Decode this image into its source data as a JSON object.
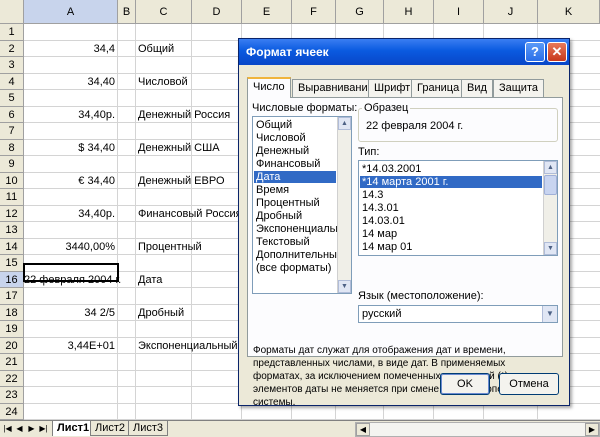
{
  "sheet": {
    "columns": [
      "A",
      "B",
      "C",
      "D",
      "E",
      "F",
      "G",
      "H",
      "I",
      "J",
      "K"
    ],
    "rows": [
      "1",
      "2",
      "3",
      "4",
      "5",
      "6",
      "7",
      "8",
      "9",
      "10",
      "11",
      "12",
      "13",
      "14",
      "15",
      "16",
      "17",
      "18",
      "19",
      "20",
      "21",
      "22",
      "23",
      "24"
    ],
    "selected_row": "16",
    "selected_col": "A",
    "cells_a": {
      "r2": "34,4",
      "r4": "34,40",
      "r6": "34,40р.",
      "r8": "$ 34,40",
      "r10": "€ 34,40",
      "r12": "34,40р.",
      "r14": "3440,00%",
      "r16": "22 февраля 2004 г.",
      "r18": "34 2/5",
      "r20": "3,44E+01"
    },
    "cells_c": {
      "r2": "Общий",
      "r4": "Числовой",
      "r6": "Денежный Россия",
      "r8": "Денежный США",
      "r10": "Денежный ЕВРО",
      "r12": "Финансовый Россия",
      "r14": "Процентный",
      "r16": "Дата",
      "r18": "Дробный",
      "r20": "Экспоненциальный"
    }
  },
  "sheet_tabs": [
    "Лист1",
    "Лист2",
    "Лист3"
  ],
  "dialog": {
    "title": "Формат ячеек",
    "help": "?",
    "close": "✕",
    "tabs": [
      "Число",
      "Выравнивание",
      "Шрифт",
      "Граница",
      "Вид",
      "Защита"
    ],
    "formats_label": "Числовые форматы:",
    "formats": [
      "Общий",
      "Числовой",
      "Денежный",
      "Финансовый",
      "Дата",
      "Время",
      "Процентный",
      "Дробный",
      "Экспоненциальный",
      "Текстовый",
      "Дополнительный",
      "(все форматы)"
    ],
    "selected_format": "Дата",
    "sample_label": "Образец",
    "sample_value": "22 февраля 2004 г.",
    "type_label": "Тип:",
    "types": [
      "*14.03.2001",
      "*14 марта 2001 г.",
      "14.3",
      "14.3.01",
      "14.03.01",
      "14 мар",
      "14 мар 01"
    ],
    "selected_type": "*14 марта 2001 г.",
    "lang_label": "Язык (местоположение):",
    "lang_value": "русский",
    "description": "Форматы дат служат для отображения дат и времени, представленных числами, в виде дат. В применяемых форматах, за исключением помеченных звездочкой (*), порядок элементов даты не меняется при смене формата операционной системы.",
    "ok_label": "OK",
    "cancel_label": "Отмена"
  },
  "icons": {
    "nav": [
      "first-sheet-icon",
      "prev-sheet-icon",
      "next-sheet-icon",
      "last-sheet-icon"
    ]
  }
}
